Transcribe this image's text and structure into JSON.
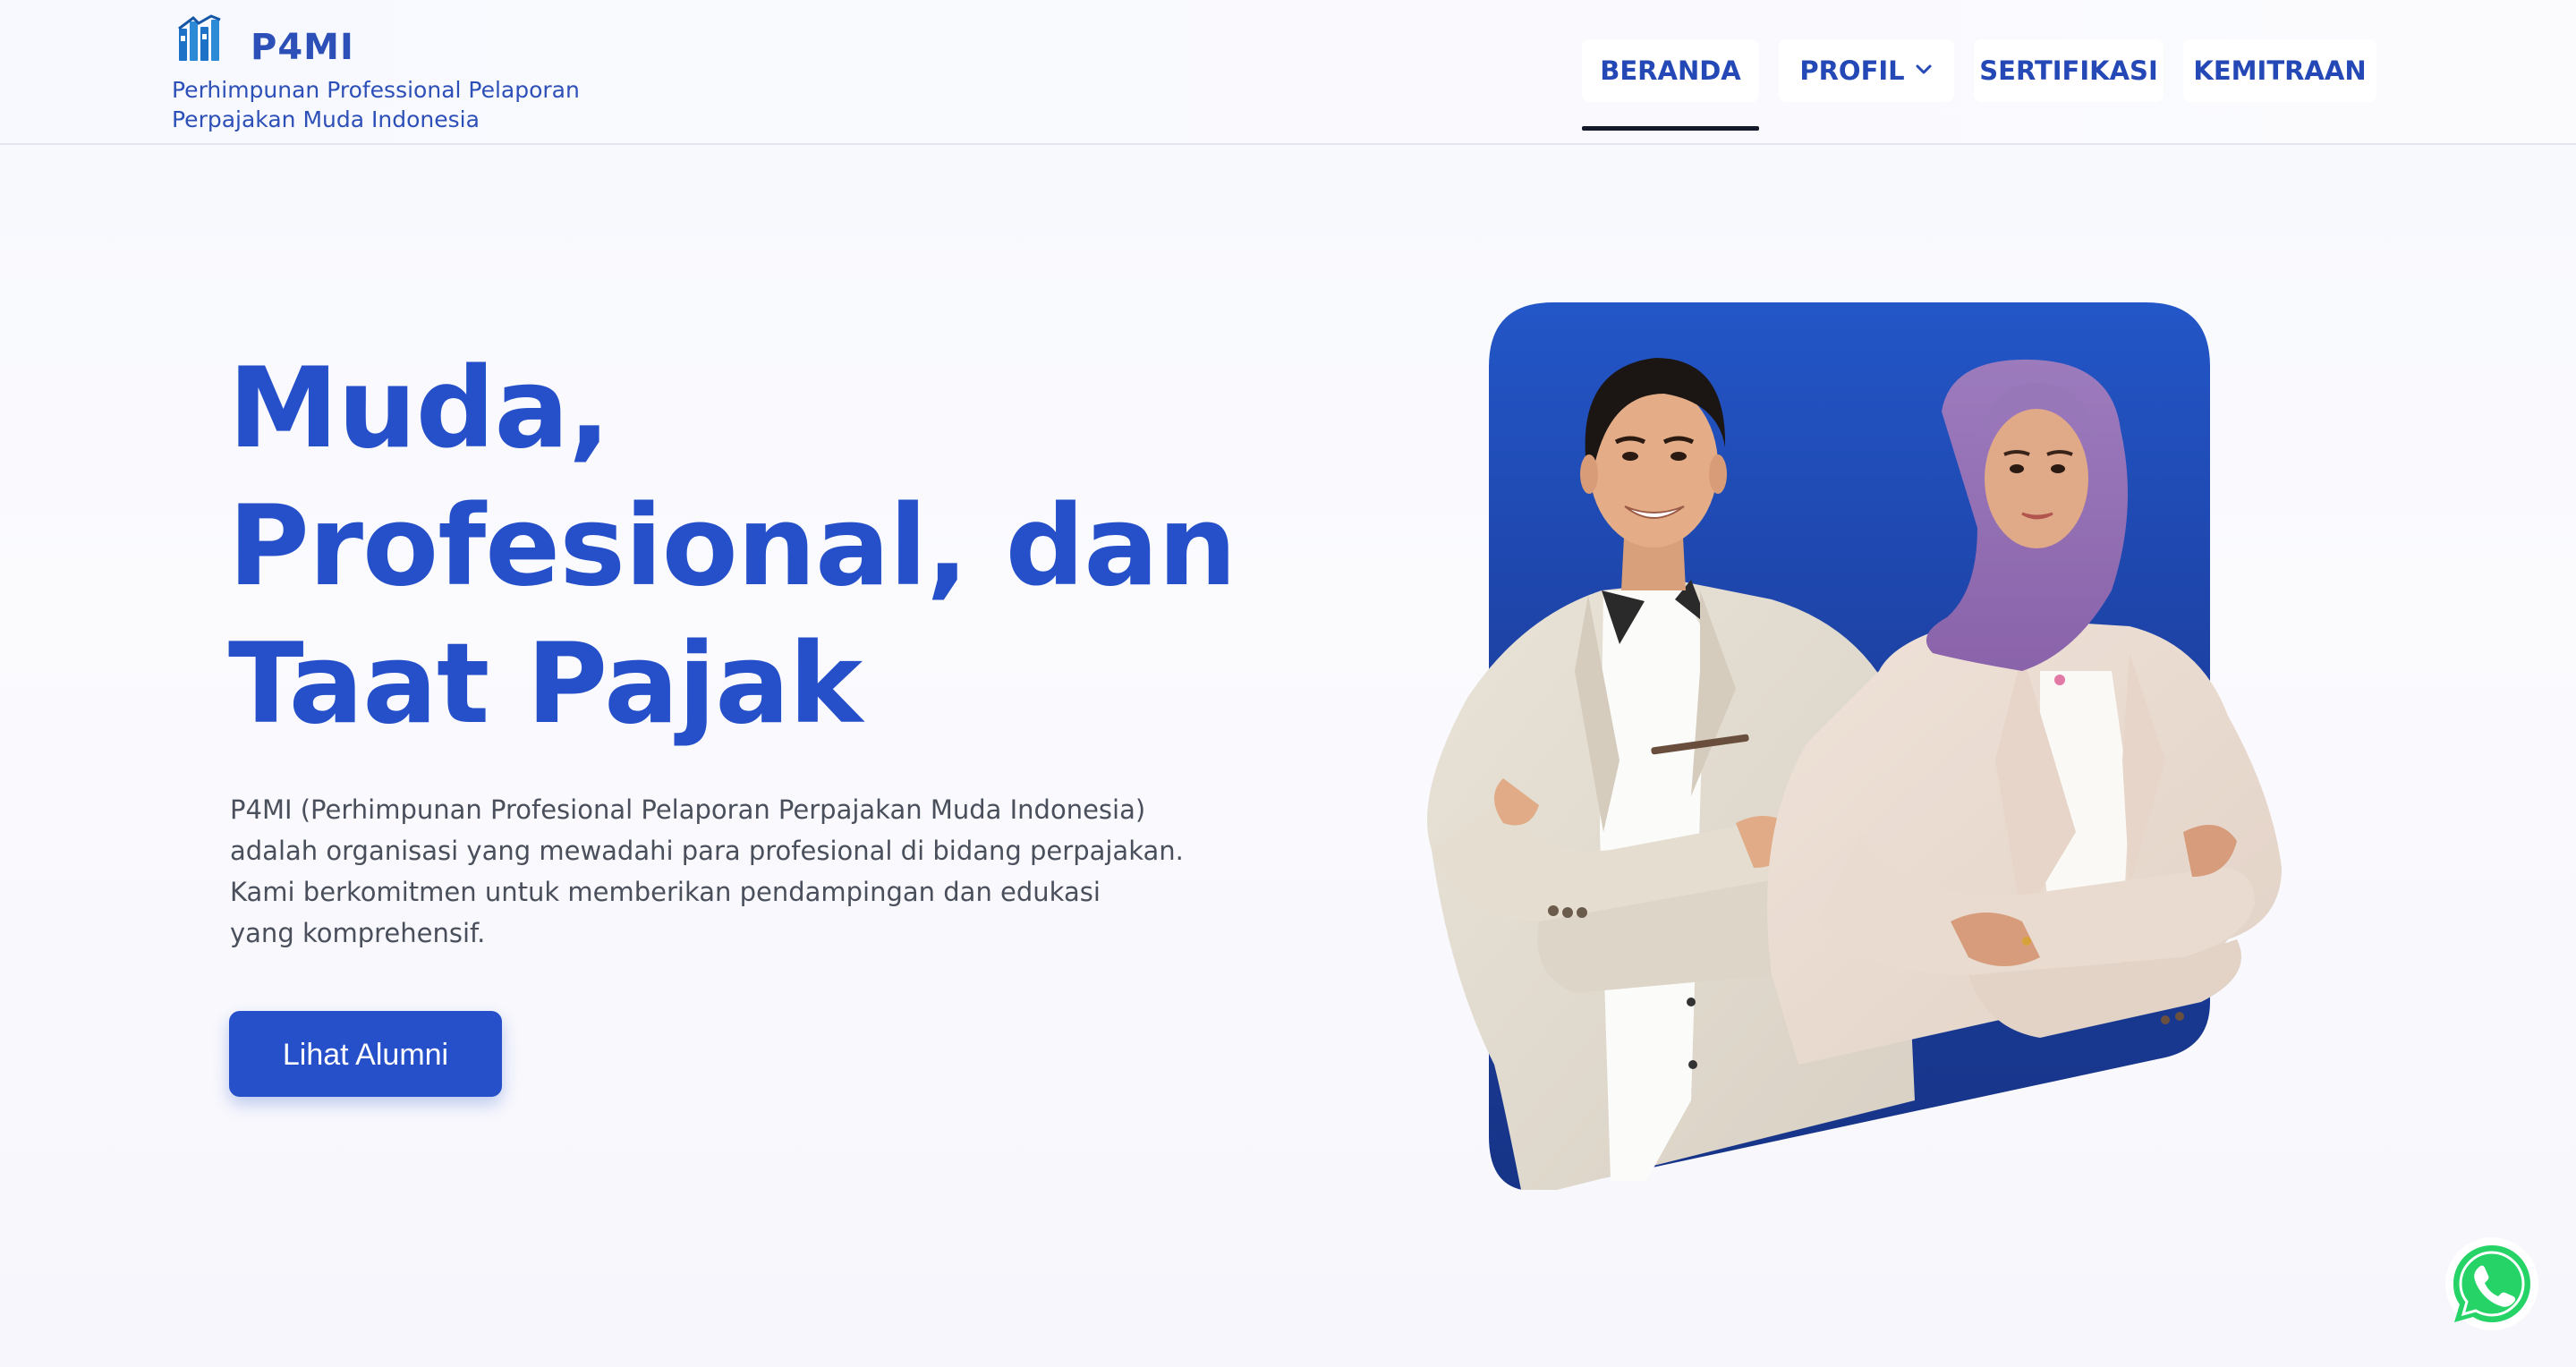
{
  "brand": {
    "name": "P4MI",
    "subtitle_line1": "Perhimpunan Professional Pelaporan",
    "subtitle_line2": "Perpajakan Muda Indonesia"
  },
  "nav": {
    "items": [
      {
        "label": "BERANDA",
        "active": true
      },
      {
        "label": "PROFIL",
        "has_dropdown": true
      },
      {
        "label": "SERTIFIKASI"
      },
      {
        "label": "KEMITRAAN"
      }
    ]
  },
  "hero": {
    "title_line1": "Muda,",
    "title_line2": "Profesional, dan",
    "title_line3": "Taat Pajak",
    "desc_line1": "P4MI (Perhimpunan Profesional Pelaporan Perpajakan Muda Indonesia)",
    "desc_line2": "adalah organisasi yang mewadahi para profesional di bidang perpajakan.",
    "desc_line3": "Kami berkomitmen untuk memberikan pendampingan dan edukasi",
    "desc_line4": "yang komprehensif.",
    "cta_label": "Lihat Alumni"
  },
  "colors": {
    "brand_blue": "#2550c9",
    "nav_text": "#2448b5",
    "photo_panel": "#1f47b3",
    "whatsapp_green": "#25d366"
  },
  "icons": {
    "logo": "p4mi-logo-icon",
    "dropdown": "chevron-down-icon",
    "whatsapp": "whatsapp-icon"
  }
}
